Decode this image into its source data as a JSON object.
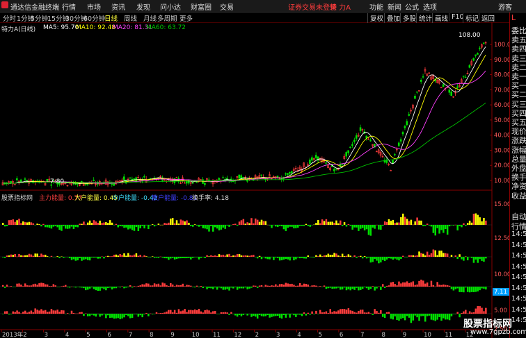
{
  "menubar": {
    "app_title": "通达信金融终端",
    "menus": [
      "行情",
      "市场",
      "资讯",
      "发现",
      "问小达",
      "财富圈",
      "交易"
    ],
    "warning": "证券交易未登录",
    "stock_name": "特 力A",
    "right_menus": [
      "功能",
      "新闻",
      "公式",
      "选项",
      "游客"
    ]
  },
  "periods": [
    "分时",
    "1分钟",
    "5分钟",
    "15分钟",
    "30分钟",
    "60分钟",
    "日线",
    "周线",
    "月线",
    "多周期",
    "更多"
  ],
  "active_period": "日线",
  "right_tools": [
    "复权",
    "叠加",
    "多股",
    "统计",
    "画线",
    "F10",
    "标记",
    "返回"
  ],
  "legend": {
    "title": "特力A(日线)",
    "ma5": "MA5: 95.70",
    "ma10": "MA10: 92.48",
    "ma20": "MA20: 81.31",
    "ma60": "MA60: 63.72"
  },
  "price_axis": [
    "100.0",
    "90.00",
    "80.00",
    "70.00",
    "60.00",
    "50.00",
    "40.00",
    "30.00",
    "20.00",
    "10.00"
  ],
  "high_label": "108.00",
  "low_label": "7.80",
  "indicator": {
    "name": "股票指标网",
    "main": "主力能量: 0.77",
    "big": "大户能量: 0.45",
    "mid": "中户能量: -0.42",
    "small": "散户能量: -0.81",
    "turnover": "换手率: 4.18"
  },
  "sub_axis": [
    "15.00",
    "12.50",
    "10.00",
    "7.11",
    "5.00",
    "2.50"
  ],
  "date_axis": [
    "2013年",
    "2",
    "3",
    "4",
    "5",
    "6",
    "7",
    "8",
    "9",
    "10",
    "11",
    "12",
    "2",
    "3",
    "4",
    "5",
    "6",
    "7",
    "8",
    "9",
    "10",
    "11",
    "12"
  ],
  "right_panel": [
    "L",
    "委比",
    "卖五",
    "卖四",
    "卖三",
    "卖二",
    "卖一",
    "买一",
    "买二",
    "买三",
    "买四",
    "买五",
    "现价",
    "涨跌",
    "涨幅",
    "总量",
    "外盘",
    "换手",
    "净资",
    "收益",
    "自动",
    "行情",
    "14:50",
    "14:50",
    "14:50",
    "14:50",
    "14:50",
    "14:50",
    "14:50",
    "14:50",
    "14:50"
  ],
  "watermark": "股票指标网",
  "watermark_url": "www.7gpzb.com",
  "colors": {
    "up": "#ff3c3c",
    "down": "#00e000",
    "ma5": "#ffffff",
    "ma10": "#ffff00",
    "ma20": "#ff40ff",
    "ma60": "#00c000"
  }
}
